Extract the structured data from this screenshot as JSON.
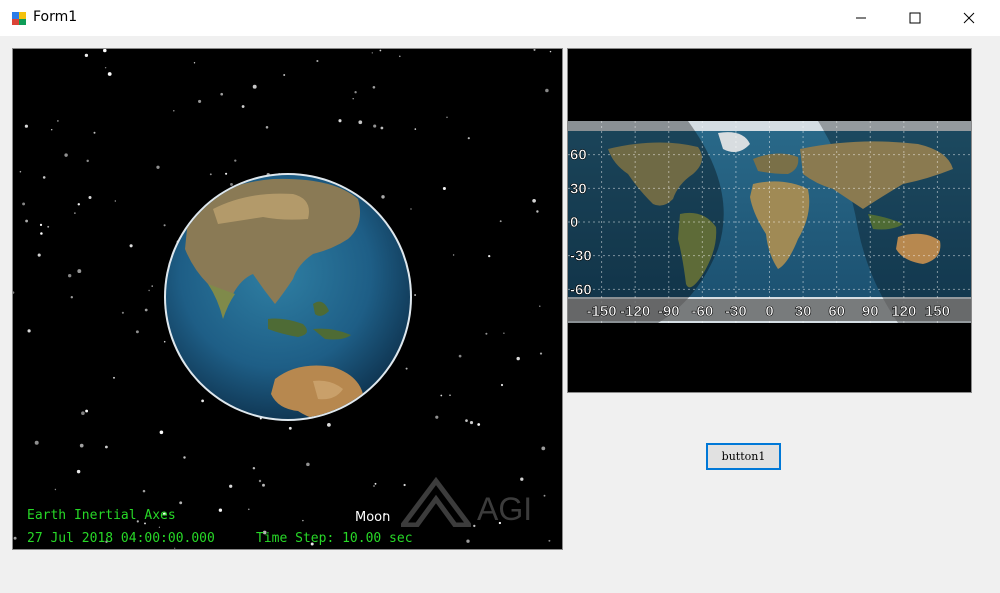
{
  "window": {
    "title": "Form1",
    "controls": {
      "minimize": "minimize",
      "maximize": "maximize",
      "close": "close"
    }
  },
  "globe_view": {
    "axes_label": "Earth Inertial Axes",
    "datetime": "27 Jul 2018 04:00:00.000",
    "time_step": "Time Step: 10.00 sec",
    "moon_label": "Moon",
    "logo_text": "AGI",
    "colors": {
      "overlay_text": "#27d827",
      "background": "#000000"
    }
  },
  "map_view": {
    "lat_labels": [
      "60",
      "30",
      "0",
      "-30",
      "-60"
    ],
    "lon_labels": [
      "-150",
      "-120",
      "-90",
      "-60",
      "-30",
      "0",
      "30",
      "60",
      "90",
      "120",
      "150"
    ]
  },
  "button1": {
    "label": "button1"
  }
}
